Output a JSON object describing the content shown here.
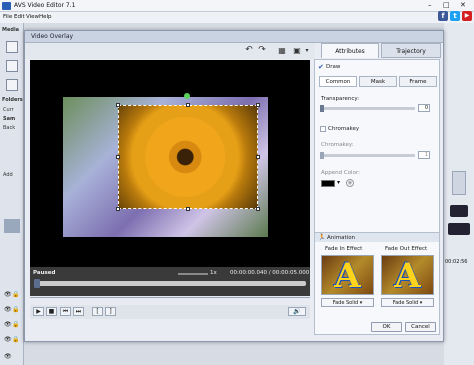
{
  "app": {
    "title": "AVS Video Editor 7.1"
  },
  "menu": [
    "File",
    "Edit",
    "View",
    "Help"
  ],
  "social": [
    {
      "icon": "facebook-icon",
      "glyph": "f",
      "color": "#3b5998"
    },
    {
      "icon": "twitter-icon",
      "glyph": "t",
      "color": "#1da1f2"
    },
    {
      "icon": "youtube-icon",
      "glyph": "▶",
      "color": "#d42020"
    }
  ],
  "left_panel": {
    "media": "Media",
    "folders": "Folders",
    "folder_items": [
      "Curr",
      "Sam",
      "Back"
    ],
    "add": "Add"
  },
  "right_strip": {
    "time": "00:02:56"
  },
  "dialog": {
    "title": "Video Overlay",
    "tabs": {
      "attributes": "Attributes",
      "trajectory": "Trajectory"
    },
    "status": {
      "state": "Paused",
      "speed": "1x",
      "time": "00:00:00.040 / 00:00:05.000"
    },
    "props": {
      "draw": "Draw",
      "modes": [
        "Common",
        "Mask",
        "Frame"
      ],
      "transparency_label": "Transparency:",
      "transparency_value": "0",
      "chromakey_check": "Chromakey",
      "chromakey_label": "Chromakey:",
      "chromakey_value": "1",
      "append_color_label": "Append Color:",
      "append_color": "#000000",
      "animation_label": "Animation",
      "fade_in_label": "Fade In Effect",
      "fade_out_label": "Fade Out Effect",
      "fade_in_value": "Fade Solid",
      "fade_out_value": "Fade Solid",
      "ok": "OK",
      "cancel": "Cancel"
    }
  }
}
